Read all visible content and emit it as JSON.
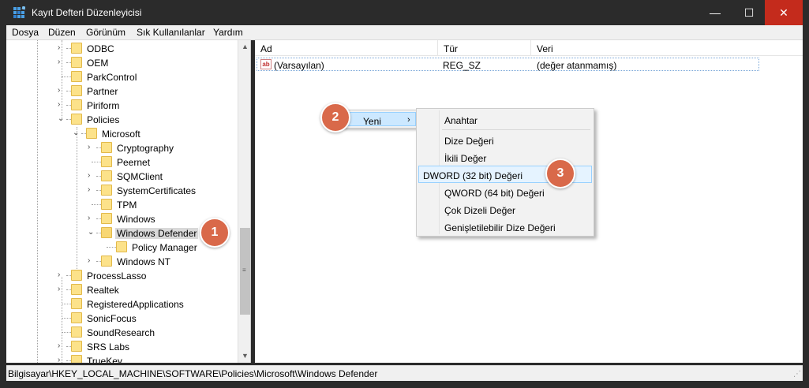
{
  "window": {
    "title": "Kayıt Defteri Düzenleyicisi",
    "icon": "registry-icon"
  },
  "window_controls": {
    "minimize": "—",
    "maximize": "☐",
    "close": "✕"
  },
  "menu": [
    "Dosya",
    "Düzen",
    "Görünüm",
    "Sık Kullanılanlar",
    "Yardım"
  ],
  "tree": {
    "items": [
      {
        "label": "ODBC",
        "expander": "›"
      },
      {
        "label": "OEM",
        "expander": "›"
      },
      {
        "label": "ParkControl",
        "expander": ""
      },
      {
        "label": "Partner",
        "expander": "›"
      },
      {
        "label": "Piriform",
        "expander": "›"
      },
      {
        "label": "Policies",
        "expander": "⌄"
      },
      {
        "label": "Microsoft",
        "expander": "⌄"
      },
      {
        "label": "Cryptography",
        "expander": "›"
      },
      {
        "label": "Peernet",
        "expander": ""
      },
      {
        "label": "SQMClient",
        "expander": "›"
      },
      {
        "label": "SystemCertificates",
        "expander": "›"
      },
      {
        "label": "TPM",
        "expander": ""
      },
      {
        "label": "Windows",
        "expander": "›"
      },
      {
        "label": "Windows Defender",
        "expander": "⌄",
        "selected": true
      },
      {
        "label": "Policy Manager",
        "expander": ""
      },
      {
        "label": "Windows NT",
        "expander": "›"
      },
      {
        "label": "ProcessLasso",
        "expander": "›"
      },
      {
        "label": "Realtek",
        "expander": "›"
      },
      {
        "label": "RegisteredApplications",
        "expander": ""
      },
      {
        "label": "SonicFocus",
        "expander": ""
      },
      {
        "label": "SoundResearch",
        "expander": ""
      },
      {
        "label": "SRS Labs",
        "expander": "›"
      },
      {
        "label": "TrueKey",
        "expander": "›"
      }
    ]
  },
  "scrollbar": {
    "up": "▲",
    "down": "▼",
    "grip": "≡"
  },
  "list": {
    "columns": [
      "Ad",
      "Tür",
      "Veri"
    ],
    "rows": [
      {
        "icon": "ab",
        "name": "(Varsayılan)",
        "type": "REG_SZ",
        "data": "(değer atanmamış)"
      }
    ]
  },
  "context_menu": {
    "label": "Yeni",
    "arrow": "›",
    "submenu": [
      "Anahtar",
      "Dize Değeri",
      "İkili Değer",
      "DWORD (32 bit) Değeri",
      "QWORD (64 bit) Değeri",
      "Çok Dizeli Değer",
      "Genişletilebilir Dize Değeri"
    ],
    "highlighted": "DWORD (32 bit) Değeri"
  },
  "badges": [
    "1",
    "2",
    "3"
  ],
  "colors": {
    "badge": "#d9694a",
    "close_button": "#c42b1c",
    "folder": "#fce28a",
    "highlight": "#cce8ff"
  },
  "statusbar": {
    "path": "Bilgisayar\\HKEY_LOCAL_MACHINE\\SOFTWARE\\Policies\\Microsoft\\Windows Defender"
  }
}
